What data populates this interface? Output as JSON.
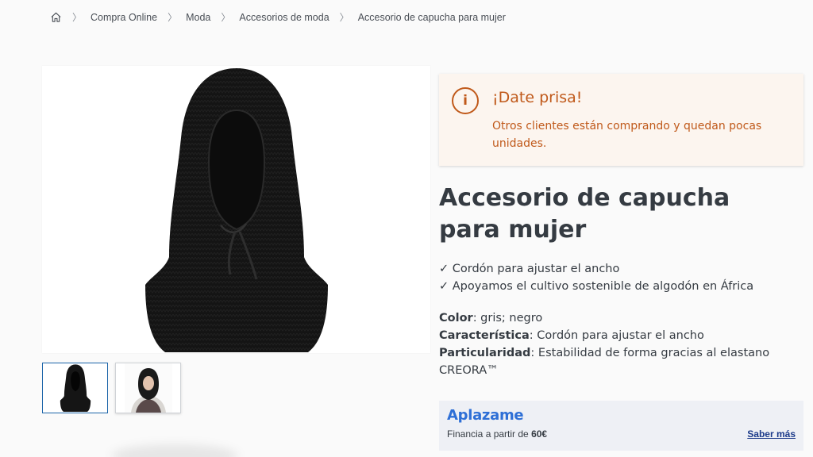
{
  "breadcrumb": {
    "home_icon": "home-icon",
    "items": [
      "Compra Online",
      "Moda",
      "Accesorios de moda",
      "Accesorio de capucha para mujer"
    ]
  },
  "alert": {
    "icon": "info-icon",
    "icon_glyph": "i",
    "title": "¡Date prisa!",
    "text": "Otros clientes están comprando y quedan pocas unidades.",
    "color": "#c0591a"
  },
  "product": {
    "title": "Accesorio de capucha para mujer",
    "features": [
      "✓ Cordón para ajustar el ancho",
      "✓ Apoyamos el cultivo sostenible de algodón en África"
    ],
    "attributes": [
      {
        "label": "Color",
        "value": ": gris; negro"
      },
      {
        "label": "Característica",
        "value": ": Cordón para ajustar el ancho"
      },
      {
        "label": "Particularidad",
        "value": ": Estabilidad de forma gracias al elastano CREORA™"
      }
    ]
  },
  "aplazame": {
    "logo": "Aplazame",
    "financing_prefix": "Financia a partir de ",
    "financing_amount": "60€",
    "link": "Saber más",
    "brand_color": "#2e6fd6"
  }
}
